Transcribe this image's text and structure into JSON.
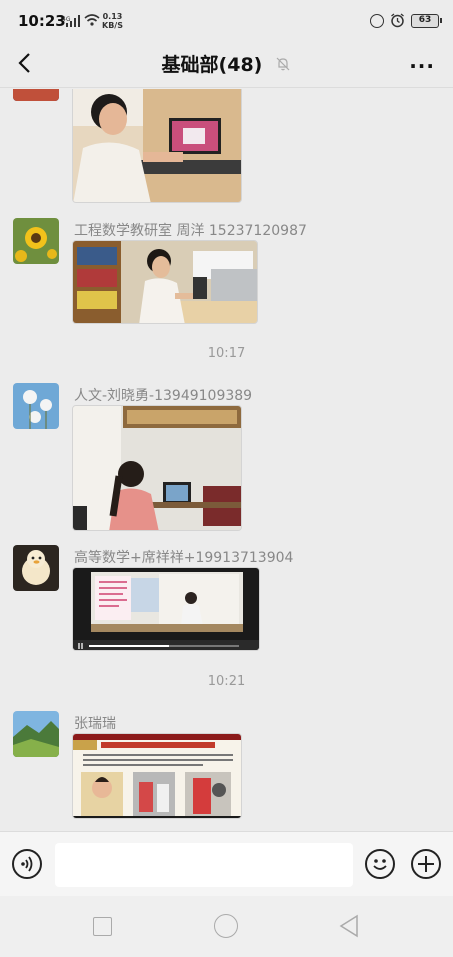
{
  "status_bar": {
    "time": "10:23",
    "network": "4G",
    "speed_value": "0.13",
    "speed_unit": "KB/S",
    "battery": "63"
  },
  "header": {
    "title": "基础部(48)",
    "more_label": "···"
  },
  "messages": [
    {
      "sender": "",
      "image": "student-at-laptop-photo"
    },
    {
      "sender": "工程数学教研室 周洋 15237120987",
      "image": "woman-at-desk-photo"
    },
    {
      "timestamp": "10:17"
    },
    {
      "sender": "人文-刘晓勇-13949109389",
      "image": "teacher-at-computer-photo"
    },
    {
      "sender": "高等数学+席祥祥+19913713904",
      "image": "video-lecture-screenshot"
    },
    {
      "timestamp": "10:21"
    },
    {
      "sender": "张瑞瑞",
      "image": "news-slide-screenshot"
    }
  ],
  "input": {
    "value": "",
    "placeholder": ""
  },
  "colors": {
    "background": "#ececec",
    "input_bar": "#f5f5f5",
    "timestamp_text": "#999999",
    "sender_text": "#888888"
  }
}
